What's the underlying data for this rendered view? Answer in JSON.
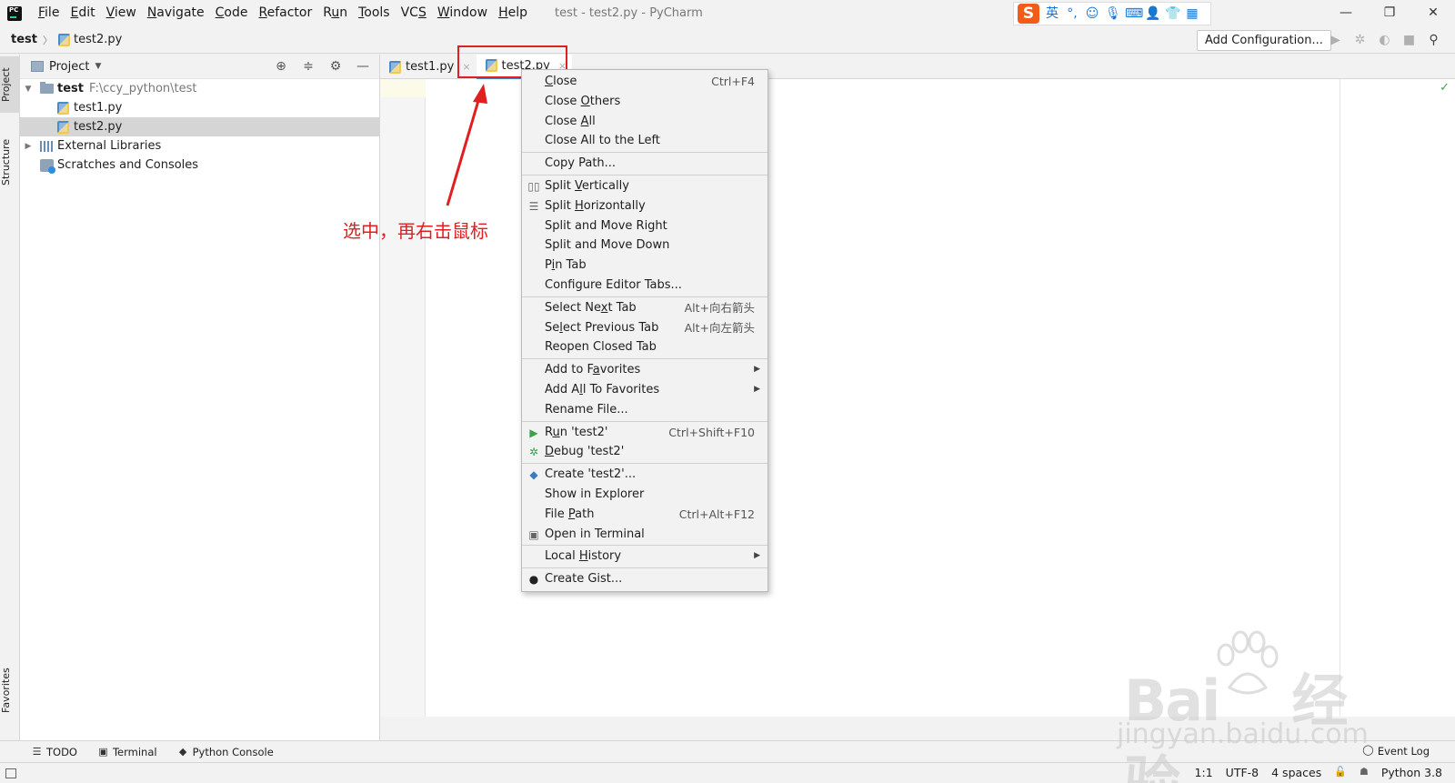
{
  "window": {
    "title": "test - test2.py - PyCharm",
    "menu": [
      {
        "pre": "",
        "u": "F",
        "post": "ile"
      },
      {
        "pre": "",
        "u": "E",
        "post": "dit"
      },
      {
        "pre": "",
        "u": "V",
        "post": "iew"
      },
      {
        "pre": "",
        "u": "N",
        "post": "avigate"
      },
      {
        "pre": "",
        "u": "C",
        "post": "ode"
      },
      {
        "pre": "",
        "u": "R",
        "post": "efactor"
      },
      {
        "pre": "R",
        "u": "u",
        "post": "n"
      },
      {
        "pre": "",
        "u": "T",
        "post": "ools"
      },
      {
        "pre": "VC",
        "u": "S",
        "post": ""
      },
      {
        "pre": "",
        "u": "W",
        "post": "indow"
      },
      {
        "pre": "",
        "u": "H",
        "post": "elp"
      }
    ],
    "ime_lang": "英"
  },
  "navbar": {
    "project": "test",
    "file": "test2.py",
    "add_configuration": "Add Configuration..."
  },
  "left_strip": {
    "project_tab": "Project",
    "structure_tab": "Structure",
    "favorites_tab": "Favorites"
  },
  "project_panel": {
    "title": "Project",
    "tree": {
      "root_name": "test",
      "root_path": "F:\\ccy_python\\test",
      "file1": "test1.py",
      "file2": "test2.py",
      "external_libraries": "External Libraries",
      "scratches": "Scratches and Consoles"
    }
  },
  "editor": {
    "tabs": [
      "test1.py",
      "test2.py"
    ]
  },
  "annotation": "选中，再右击鼠标",
  "context_menu": {
    "close": {
      "pre": "",
      "u": "C",
      "post": "lose",
      "shortcut": "Ctrl+F4"
    },
    "close_others": {
      "pre": "Close ",
      "u": "O",
      "post": "thers"
    },
    "close_all": {
      "pre": "Close ",
      "u": "A",
      "post": "ll"
    },
    "close_all_left": "Close All to the Left",
    "copy_path": "Copy Path...",
    "split_vertically": {
      "pre": "Split ",
      "u": "V",
      "post": "ertically"
    },
    "split_horizontally": {
      "pre": "Split ",
      "u": "H",
      "post": "orizontally"
    },
    "split_move_right": "Split and Move Right",
    "split_move_down": "Split and Move Down",
    "pin_tab": {
      "pre": "P",
      "u": "i",
      "post": "n Tab"
    },
    "configure_tabs": "Configure Editor Tabs...",
    "select_next": {
      "pre": "Select Ne",
      "u": "x",
      "post": "t Tab",
      "shortcut": "Alt+向右箭头"
    },
    "select_prev": {
      "pre": "Se",
      "u": "l",
      "post": "ect Previous Tab",
      "shortcut": "Alt+向左箭头"
    },
    "reopen_closed": "Reopen Closed Tab",
    "add_favorites": {
      "pre": "Add to F",
      "u": "a",
      "post": "vorites"
    },
    "add_all_favorites": {
      "pre": "Add A",
      "u": "l",
      "post": "l To Favorites"
    },
    "rename_file": "Rename File...",
    "run": {
      "pre": "R",
      "u": "u",
      "post": "n 'test2'",
      "shortcut": "Ctrl+Shift+F10"
    },
    "debug": {
      "pre": "",
      "u": "D",
      "post": "ebug 'test2'"
    },
    "create": "Create 'test2'...",
    "show_explorer": "Show in Explorer",
    "file_path": {
      "pre": "File ",
      "u": "P",
      "post": "ath",
      "shortcut": "Ctrl+Alt+F12"
    },
    "open_terminal": "Open in Terminal",
    "local_history": {
      "pre": "Local ",
      "u": "H",
      "post": "istory"
    },
    "create_gist": "Create Gist..."
  },
  "bottom_bar": {
    "todo": "TODO",
    "terminal": "Terminal",
    "python_console": "Python Console",
    "event_log": "Event Log"
  },
  "status_bar": {
    "position": "1:1",
    "encoding": "UTF-8",
    "indent": "4 spaces",
    "interpreter": "Python 3.8"
  },
  "watermark": {
    "brand": "Bai",
    "brand2": "经验",
    "url": "jingyan.baidu.com"
  },
  "colors": {
    "accent": "#4083c9",
    "annotation": "#e02020",
    "run_green": "#3aa34a"
  }
}
